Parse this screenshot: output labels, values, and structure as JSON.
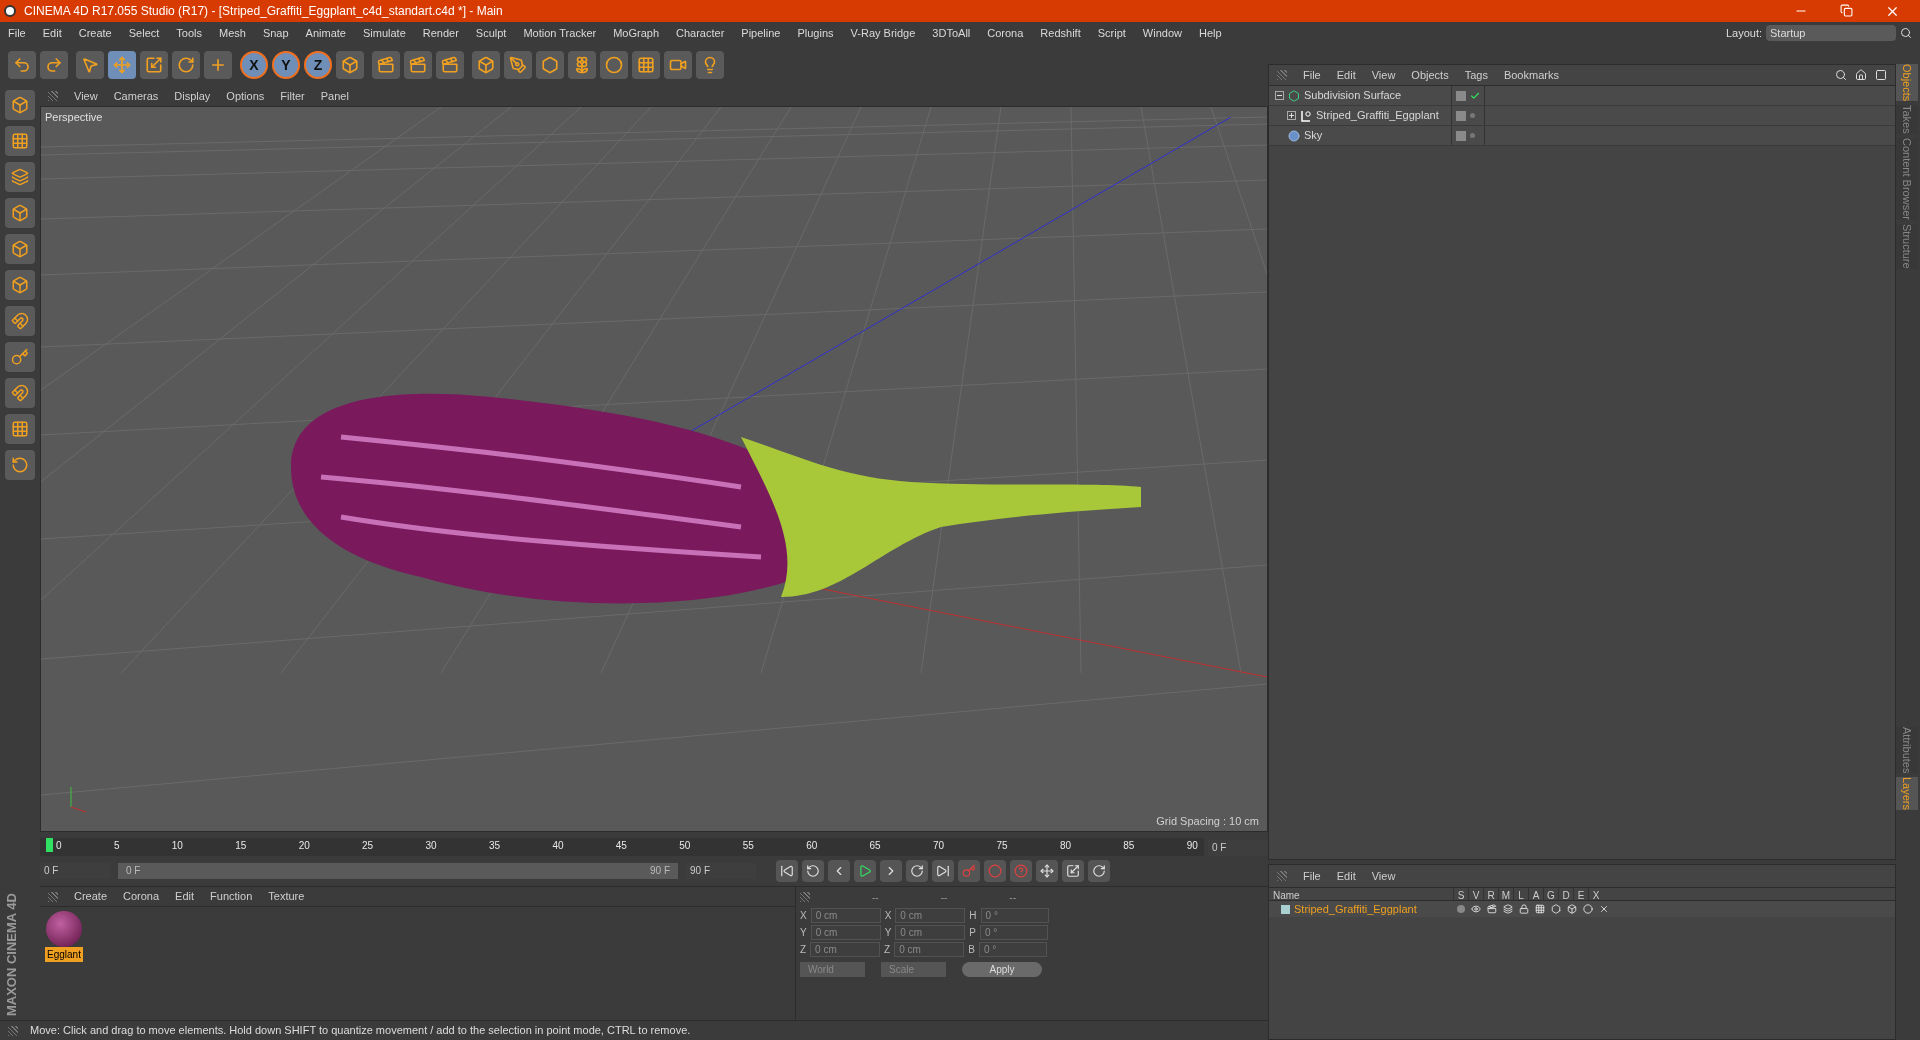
{
  "window": {
    "title": "CINEMA 4D R17.055 Studio (R17) - [Striped_Graffiti_Eggplant_c4d_standart.c4d *] - Main"
  },
  "menu": [
    "File",
    "Edit",
    "Create",
    "Select",
    "Tools",
    "Mesh",
    "Snap",
    "Animate",
    "Simulate",
    "Render",
    "Sculpt",
    "Motion Tracker",
    "MoGraph",
    "Character",
    "Pipeline",
    "Plugins",
    "V-Ray Bridge",
    "3DToAll",
    "Corona",
    "Redshift",
    "Script",
    "Window",
    "Help"
  ],
  "layout": {
    "label": "Layout:",
    "value": "Startup"
  },
  "axis_buttons": [
    "X",
    "Y",
    "Z"
  ],
  "viewport": {
    "menu": [
      "View",
      "Cameras",
      "Display",
      "Options",
      "Filter",
      "Panel"
    ],
    "camera": "Perspective",
    "grid_spacing": "Grid Spacing : 10 cm"
  },
  "timeline": {
    "ticks": [
      "0",
      "5",
      "10",
      "15",
      "20",
      "25",
      "30",
      "35",
      "40",
      "45",
      "50",
      "55",
      "60",
      "65",
      "70",
      "75",
      "80",
      "85",
      "90"
    ],
    "level": 0,
    "current": "0 F",
    "start": "0 F",
    "range": {
      "start": "0 F",
      "end": "90 F",
      "level": 1
    },
    "end": "90 F"
  },
  "materials": {
    "menu": [
      "Create",
      "Corona",
      "Edit",
      "Function",
      "Texture"
    ],
    "items": [
      {
        "name": "Egglant",
        "selected": true
      }
    ]
  },
  "coordinates": {
    "headers": [
      "--",
      "--",
      "--"
    ],
    "rows": [
      {
        "a": "X",
        "av": "0 cm",
        "b": "X",
        "bv": "0 cm",
        "c": "H",
        "cv": "0 °"
      },
      {
        "a": "Y",
        "av": "0 cm",
        "b": "Y",
        "bv": "0 cm",
        "c": "P",
        "cv": "0 °"
      },
      {
        "a": "Z",
        "av": "0 cm",
        "b": "Z",
        "bv": "0 cm",
        "c": "B",
        "cv": "0 °"
      }
    ],
    "mode": "World",
    "transform": "Scale",
    "apply": "Apply"
  },
  "status_bar": "Move: Click and drag to move elements. Hold down SHIFT to quantize movement / add to the selection in point mode, CTRL to remove.",
  "objects": {
    "menu": [
      "File",
      "Edit",
      "View",
      "Objects",
      "Tags",
      "Bookmarks"
    ],
    "tree": [
      {
        "name": "Subdivision Surface",
        "kind": "subdivision",
        "expanded": true,
        "enabled": true,
        "children": [
          {
            "name": "Striped_Graffiti_Eggplant",
            "kind": "null",
            "expanded": false,
            "enabled": false
          }
        ]
      },
      {
        "name": "Sky",
        "kind": "sky",
        "enabled": false
      }
    ]
  },
  "layers": {
    "menu": [
      "File",
      "Edit",
      "View"
    ],
    "columns": [
      "Name",
      "S",
      "V",
      "R",
      "M",
      "L",
      "A",
      "G",
      "D",
      "E",
      "X"
    ],
    "rows": [
      {
        "name": "Striped_Graffiti_Eggplant",
        "color": "#a8d0d0"
      }
    ]
  },
  "side_tabs_top": [
    {
      "label": "Objects",
      "selected": true
    },
    {
      "label": "Takes",
      "selected": false
    },
    {
      "label": "Content Browser",
      "selected": false
    },
    {
      "label": "Structure",
      "selected": false
    }
  ],
  "side_tabs_bottom": [
    {
      "label": "Attributes",
      "selected": false
    },
    {
      "label": "Layers",
      "selected": true
    }
  ],
  "brand": "MAXON CINEMA 4D"
}
